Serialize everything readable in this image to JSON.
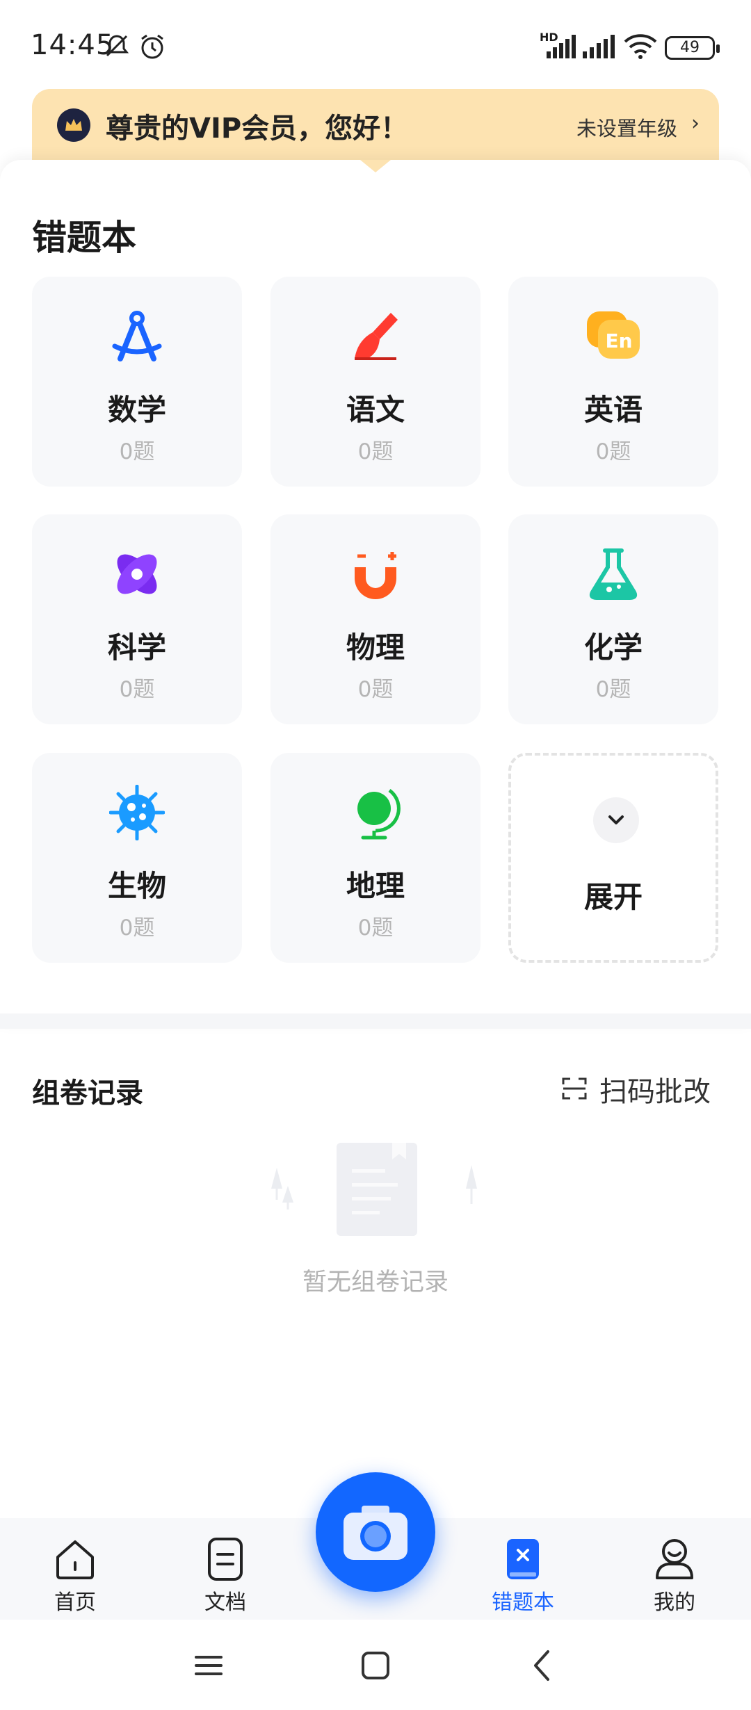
{
  "status_bar": {
    "time": "14:45",
    "battery": "49",
    "network_label": "HD"
  },
  "vip_banner": {
    "title": "尊贵的VIP会员，您好！",
    "grade_link": "未设置年级",
    "chevron": "›",
    "background_color": "#fde3b1"
  },
  "wrong_book": {
    "title": "错题本",
    "subjects": [
      {
        "name": "数学",
        "count": "0题",
        "icon": "compass-icon",
        "color": "#1a64ff"
      },
      {
        "name": "语文",
        "count": "0题",
        "icon": "brush-icon",
        "color": "#ff3b30"
      },
      {
        "name": "英语",
        "count": "0题",
        "icon": "english-bubble-icon",
        "color": "#ffa41b"
      },
      {
        "name": "科学",
        "count": "0题",
        "icon": "atom-icon",
        "color": "#7a2cf0"
      },
      {
        "name": "物理",
        "count": "0题",
        "icon": "magnet-icon",
        "color": "#ff5a1f"
      },
      {
        "name": "化学",
        "count": "0题",
        "icon": "flask-icon",
        "color": "#1cc6a5"
      },
      {
        "name": "生物",
        "count": "0题",
        "icon": "virus-icon",
        "color": "#1a9bff"
      },
      {
        "name": "地理",
        "count": "0题",
        "icon": "globe-icon",
        "color": "#18c045"
      }
    ],
    "expand_label": "展开"
  },
  "records": {
    "title": "组卷记录",
    "scan_label": "扫码批改",
    "empty_text": "暂无组卷记录"
  },
  "bottom_nav": {
    "tabs": [
      {
        "label": "首页",
        "icon": "home-icon",
        "active": false
      },
      {
        "label": "文档",
        "icon": "document-icon",
        "active": false
      },
      {
        "label": "错题本",
        "icon": "wrong-book-icon",
        "active": true
      },
      {
        "label": "我的",
        "icon": "profile-icon",
        "active": false
      }
    ],
    "camera_icon": "camera-icon",
    "accent_color": "#1a64ff"
  }
}
